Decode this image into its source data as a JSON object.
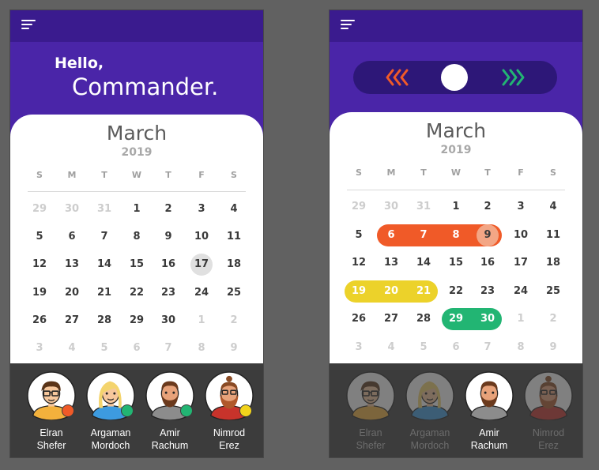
{
  "left_screen": {
    "greeting": "Hello,",
    "name": "Commander.",
    "calendar": {
      "month": "March",
      "year": "2019",
      "weekdays": [
        "S",
        "M",
        "T",
        "W",
        "T",
        "F",
        "S"
      ],
      "weeks": [
        [
          "29",
          "30",
          "31",
          "1",
          "2",
          "3",
          "4"
        ],
        [
          "5",
          "6",
          "7",
          "8",
          "9",
          "10",
          "11"
        ],
        [
          "12",
          "13",
          "14",
          "15",
          "16",
          "17",
          "18"
        ],
        [
          "19",
          "20",
          "21",
          "22",
          "23",
          "24",
          "25"
        ],
        [
          "26",
          "27",
          "28",
          "29",
          "30",
          "1",
          "2"
        ],
        [
          "3",
          "4",
          "5",
          "6",
          "7",
          "8",
          "9"
        ]
      ],
      "today": "17"
    },
    "people": [
      {
        "first": "Elran",
        "last": "Shefer",
        "status_color": "#f05a28"
      },
      {
        "first": "Argaman",
        "last": "Mordoch",
        "status_color": "#22b573"
      },
      {
        "first": "Amir",
        "last": "Rachum",
        "status_color": "#22b573"
      },
      {
        "first": "Nimrod",
        "last": "Erez",
        "status_color": "#f2d31b"
      }
    ]
  },
  "right_screen": {
    "slider": {
      "left_icon": "chevrons-left-icon",
      "right_icon": "chevrons-right-icon",
      "left_color": "#f05a28",
      "right_color": "#22b573"
    },
    "calendar": {
      "month": "March",
      "year": "2019",
      "weekdays": [
        "S",
        "M",
        "T",
        "W",
        "T",
        "F",
        "S"
      ],
      "weeks": [
        [
          "29",
          "30",
          "31",
          "1",
          "2",
          "3",
          "4"
        ],
        [
          "5",
          "6",
          "7",
          "8",
          "9",
          "10",
          "11"
        ],
        [
          "12",
          "13",
          "14",
          "15",
          "16",
          "17",
          "18"
        ],
        [
          "19",
          "20",
          "21",
          "22",
          "23",
          "24",
          "25"
        ],
        [
          "26",
          "27",
          "28",
          "29",
          "30",
          "1",
          "2"
        ],
        [
          "3",
          "4",
          "5",
          "6",
          "7",
          "8",
          "9"
        ]
      ],
      "ranges": [
        {
          "days": [
            "6",
            "7",
            "8",
            "9"
          ],
          "color": "#f05a28"
        },
        {
          "days": [
            "19",
            "20",
            "21"
          ],
          "color": "#ecd22a"
        },
        {
          "days": [
            "29",
            "30"
          ],
          "color": "#22b573"
        }
      ]
    },
    "people": [
      {
        "first": "Elran",
        "last": "Shefer",
        "active": false
      },
      {
        "first": "Argaman",
        "last": "Mordoch",
        "active": false
      },
      {
        "first": "Amir",
        "last": "Rachum",
        "active": true
      },
      {
        "first": "Nimrod",
        "last": "Erez",
        "active": false
      }
    ]
  },
  "colors": {
    "header": "#4a25a8",
    "topbar": "#3a1b8e",
    "bottom": "#3c3c3c"
  }
}
